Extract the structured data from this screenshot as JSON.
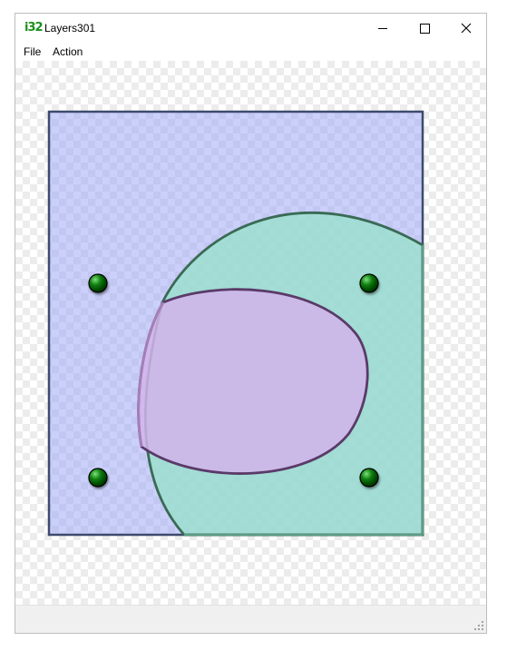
{
  "window": {
    "title": "Layers301",
    "app_icon_text": "i32"
  },
  "menu": {
    "items": [
      "File",
      "Action"
    ]
  },
  "canvas": {
    "layers": [
      {
        "name": "rectangle",
        "fill": "#c8ccf8",
        "stroke": "#3e4a6e"
      },
      {
        "name": "teal-ellipse",
        "fill": "#a8e4d4",
        "stroke": "#3a6a55"
      },
      {
        "name": "purple-ellipse",
        "fill": "#d4b8e8",
        "stroke": "#5a3a68"
      }
    ],
    "handle_color": "#0a7a0a"
  }
}
